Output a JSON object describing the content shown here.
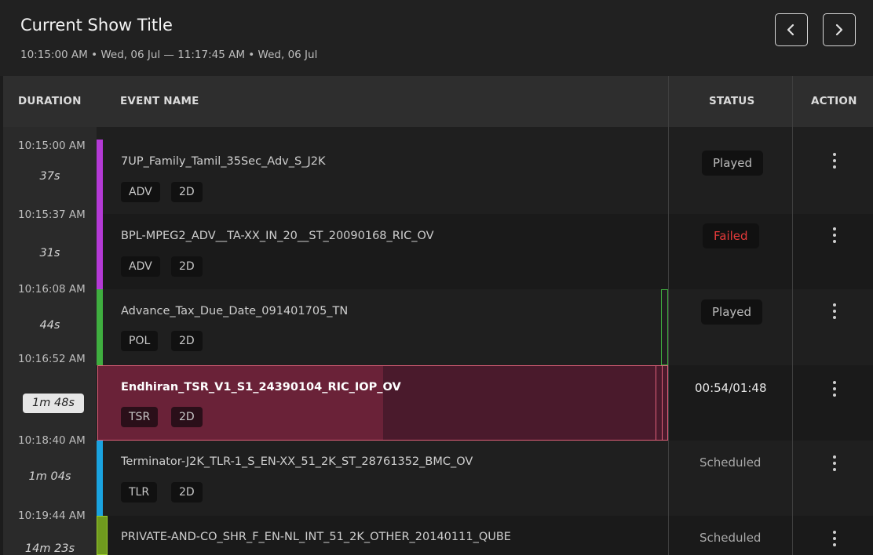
{
  "show": {
    "title": "Current Show Title",
    "time_range": "10:15:00 AM • Wed, 06 Jul  —  11:17:45 AM • Wed, 06 Jul"
  },
  "columns": {
    "duration": "DURATION",
    "event_name": "EVENT NAME",
    "status": "STATUS",
    "action": "ACTION"
  },
  "events": [
    {
      "start": "10:15:00 AM",
      "duration": "37s",
      "name": "7UP_Family_Tamil_35Sec_Adv_S_J2K",
      "tags": [
        "ADV",
        "2D"
      ],
      "status": "Played",
      "color": "#b43ad6"
    },
    {
      "start": "10:15:37 AM",
      "duration": "31s",
      "name": "BPL-MPEG2_ADV__TA-XX_IN_20__ST_20090168_RIC_OV",
      "tags": [
        "ADV",
        "2D"
      ],
      "status": "Failed",
      "color": "#b43ad6"
    },
    {
      "start": "10:16:08 AM",
      "duration": "44s",
      "name": "Advance_Tax_Due_Date_091401705_TN",
      "tags": [
        "POL",
        "2D"
      ],
      "status": "Played",
      "color": "#3fae3f"
    },
    {
      "start": "10:16:52 AM",
      "duration": "1m 48s",
      "name": "Endhiran_TSR_V1_S1_24390104_RIC_IOP_OV",
      "tags": [
        "TSR",
        "2D"
      ],
      "status": "00:54/01:48",
      "color": "#e0607a",
      "progress": 0.5
    },
    {
      "start": "10:18:40 AM",
      "duration": "1m 04s",
      "name": "Terminator-J2K_TLR-1_S_EN-XX_51_2K_ST_28761352_BMC_OV",
      "tags": [
        "TLR",
        "2D"
      ],
      "status": "Scheduled",
      "color": "#1aa3e0"
    },
    {
      "start": "10:19:44 AM",
      "duration": "14m 23s",
      "name": "PRIVATE-AND-CO_SHR_F_EN-NL_INT_51_2K_OTHER_20140111_QUBE",
      "tags": [],
      "status": "Scheduled",
      "color": "#9acd2e"
    }
  ],
  "icons": {
    "prev": "chevron-left-icon",
    "next": "chevron-right-icon",
    "menu": "more-vertical-icon"
  }
}
